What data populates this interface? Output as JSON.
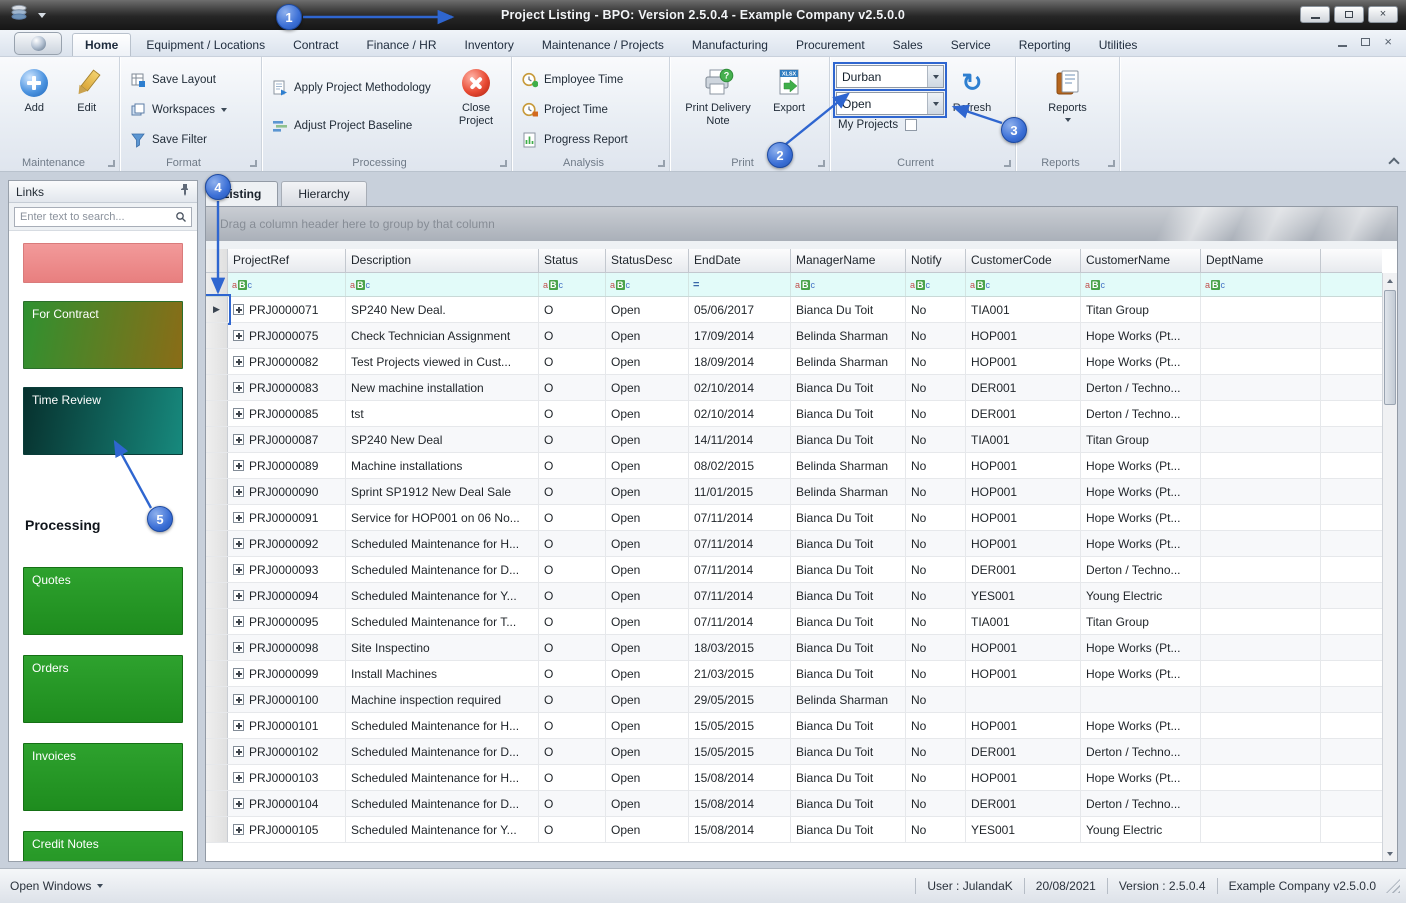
{
  "window": {
    "title_main": "Project Listing",
    "title_rest": " - BPO: Version 2.5.0.4 - Example Company v2.5.0.0"
  },
  "ribbon": {
    "tabs": [
      "Home",
      "Equipment / Locations",
      "Contract",
      "Finance / HR",
      "Inventory",
      "Maintenance / Projects",
      "Manufacturing",
      "Procurement",
      "Sales",
      "Service",
      "Reporting",
      "Utilities"
    ],
    "active_tab": "Home",
    "group_labels": [
      "Maintenance",
      "Format",
      "Processing",
      "Analysis",
      "Print",
      "Current",
      "Reports"
    ],
    "maintenance": {
      "add": "Add",
      "edit": "Edit"
    },
    "format": {
      "save_layout": "Save Layout",
      "workspaces": "Workspaces",
      "save_filter": "Save Filter"
    },
    "processing": {
      "apply": "Apply Project Methodology",
      "adjust": "Adjust Project Baseline",
      "close": "Close Project"
    },
    "analysis": {
      "employee_time": "Employee Time",
      "project_time": "Project Time",
      "progress": "Progress Report"
    },
    "print": {
      "delivery": "Print Delivery Note",
      "export": "Export"
    },
    "current": {
      "site": "Durban",
      "status": "Open",
      "my_projects": "My Projects",
      "refresh": "Refresh"
    },
    "reports": {
      "reports": "Reports"
    }
  },
  "sidebar": {
    "title": "Links",
    "search_placeholder": "Enter text to search...",
    "shortcuts": [
      {
        "label": "",
        "style": "pink"
      },
      {
        "label": "For Contract",
        "style": "contract"
      },
      {
        "label": "Time Review",
        "style": "time"
      }
    ],
    "section_heading": "Processing",
    "processing_shortcuts": [
      {
        "label": "Quotes",
        "style": "green"
      },
      {
        "label": "Orders",
        "style": "green"
      },
      {
        "label": "Invoices",
        "style": "green"
      },
      {
        "label": "Credit Notes",
        "style": "green"
      }
    ]
  },
  "doc_tabs": {
    "listing": "Listing",
    "hierarchy": "Hierarchy"
  },
  "grid": {
    "group_hint": "Drag a column header here to group by that column",
    "columns": [
      {
        "label": "ProjectRef",
        "filter": "aBc"
      },
      {
        "label": "Description",
        "filter": "aBc"
      },
      {
        "label": "Status",
        "filter": "aBc"
      },
      {
        "label": "StatusDesc",
        "filter": "aBc"
      },
      {
        "label": "EndDate",
        "filter": "="
      },
      {
        "label": "ManagerName",
        "filter": "aBc"
      },
      {
        "label": "Notify",
        "filter": "aBc"
      },
      {
        "label": "CustomerCode",
        "filter": "aBc"
      },
      {
        "label": "CustomerName",
        "filter": "aBc"
      },
      {
        "label": "DeptName",
        "filter": "aBc"
      }
    ],
    "rows": [
      [
        "PRJ0000071",
        "SP240 New Deal.",
        "O",
        "Open",
        "05/06/2017",
        "Bianca Du Toit",
        "No",
        "TIA001",
        "Titan Group",
        ""
      ],
      [
        "PRJ0000075",
        "Check Technician Assignment",
        "O",
        "Open",
        "17/09/2014",
        "Belinda Sharman",
        "No",
        "HOP001",
        "Hope Works (Pt...",
        ""
      ],
      [
        "PRJ0000082",
        "Test Projects viewed in Cust...",
        "O",
        "Open",
        "18/09/2014",
        "Belinda Sharman",
        "No",
        "HOP001",
        "Hope Works (Pt...",
        ""
      ],
      [
        "PRJ0000083",
        "New machine installation",
        "O",
        "Open",
        "02/10/2014",
        "Bianca Du Toit",
        "No",
        "DER001",
        "Derton / Techno...",
        ""
      ],
      [
        "PRJ0000085",
        "tst",
        "O",
        "Open",
        "02/10/2014",
        "Bianca Du Toit",
        "No",
        "DER001",
        "Derton / Techno...",
        ""
      ],
      [
        "PRJ0000087",
        "SP240 New Deal",
        "O",
        "Open",
        "14/11/2014",
        "Bianca Du Toit",
        "No",
        "TIA001",
        "Titan Group",
        ""
      ],
      [
        "PRJ0000089",
        "Machine installations",
        "O",
        "Open",
        "08/02/2015",
        "Belinda Sharman",
        "No",
        "HOP001",
        "Hope Works (Pt...",
        ""
      ],
      [
        "PRJ0000090",
        "Sprint SP1912 New Deal Sale",
        "O",
        "Open",
        "11/01/2015",
        "Belinda Sharman",
        "No",
        "HOP001",
        "Hope Works (Pt...",
        ""
      ],
      [
        "PRJ0000091",
        "Service for HOP001 on 06 No...",
        "O",
        "Open",
        "07/11/2014",
        "Bianca Du Toit",
        "No",
        "HOP001",
        "Hope Works (Pt...",
        ""
      ],
      [
        "PRJ0000092",
        "Scheduled Maintenance for H...",
        "O",
        "Open",
        "07/11/2014",
        "Bianca Du Toit",
        "No",
        "HOP001",
        "Hope Works (Pt...",
        ""
      ],
      [
        "PRJ0000093",
        "Scheduled Maintenance for D...",
        "O",
        "Open",
        "07/11/2014",
        "Bianca Du Toit",
        "No",
        "DER001",
        "Derton / Techno...",
        ""
      ],
      [
        "PRJ0000094",
        "Scheduled Maintenance for Y...",
        "O",
        "Open",
        "07/11/2014",
        "Bianca Du Toit",
        "No",
        "YES001",
        "Young Electric",
        ""
      ],
      [
        "PRJ0000095",
        "Scheduled Maintenance for T...",
        "O",
        "Open",
        "07/11/2014",
        "Bianca Du Toit",
        "No",
        "TIA001",
        "Titan Group",
        ""
      ],
      [
        "PRJ0000098",
        "Site Inspectino",
        "O",
        "Open",
        "18/03/2015",
        "Bianca Du Toit",
        "No",
        "HOP001",
        "Hope Works (Pt...",
        ""
      ],
      [
        "PRJ0000099",
        "Install Machines",
        "O",
        "Open",
        "21/03/2015",
        "Bianca Du Toit",
        "No",
        "HOP001",
        "Hope Works (Pt...",
        ""
      ],
      [
        "PRJ0000100",
        "Machine inspection required",
        "O",
        "Open",
        "29/05/2015",
        "Belinda Sharman",
        "No",
        "",
        "",
        ""
      ],
      [
        "PRJ0000101",
        "Scheduled Maintenance for H...",
        "O",
        "Open",
        "15/05/2015",
        "Bianca Du Toit",
        "No",
        "HOP001",
        "Hope Works (Pt...",
        ""
      ],
      [
        "PRJ0000102",
        "Scheduled Maintenance for D...",
        "O",
        "Open",
        "15/05/2015",
        "Bianca Du Toit",
        "No",
        "DER001",
        "Derton / Techno...",
        ""
      ],
      [
        "PRJ0000103",
        "Scheduled Maintenance for H...",
        "O",
        "Open",
        "15/08/2014",
        "Bianca Du Toit",
        "No",
        "HOP001",
        "Hope Works (Pt...",
        ""
      ],
      [
        "PRJ0000104",
        "Scheduled Maintenance for D...",
        "O",
        "Open",
        "15/08/2014",
        "Bianca Du Toit",
        "No",
        "DER001",
        "Derton / Techno...",
        ""
      ],
      [
        "PRJ0000105",
        "Scheduled Maintenance for Y...",
        "O",
        "Open",
        "15/08/2014",
        "Bianca Du Toit",
        "No",
        "YES001",
        "Young Electric",
        ""
      ]
    ]
  },
  "statusbar": {
    "open_windows": "Open Windows",
    "user": "User : JulandaK",
    "date": "20/08/2021",
    "version": "Version : 2.5.0.4",
    "company": "Example Company v2.5.0.0"
  },
  "annotations": {
    "steps": [
      "1",
      "2",
      "3",
      "4",
      "5"
    ]
  },
  "icons": {
    "row_marker": "▶",
    "refresh_glyph": "↻",
    "print_badge": "?",
    "export_doc_label": "XLSX",
    "close_glyph": "×"
  }
}
